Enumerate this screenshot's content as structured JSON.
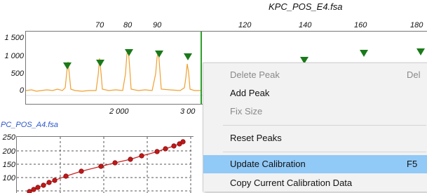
{
  "file_title": "KPC_POS_E4.fsa",
  "top_plot": {
    "x_ticks_upper": [
      "70",
      "80",
      "90",
      "120",
      "140",
      "160",
      "180"
    ],
    "x_ticks_lower": [
      "2 000",
      "3 00"
    ],
    "y_ticks": [
      "1 500",
      "1 000",
      "500",
      "0"
    ],
    "colors": {
      "trace": "#f0a030",
      "marker": "#1a7a1a",
      "cursor": "#2aa12a"
    }
  },
  "cal_plot": {
    "title": "PC_POS_A4.fsa",
    "y_ticks": [
      "250",
      "200",
      "150",
      "100"
    ],
    "colors": {
      "line": "#cc2222",
      "point": "#c21818",
      "title": "#2a56c6"
    }
  },
  "context_menu": {
    "items": [
      {
        "label": "Delete Peak",
        "shortcut": "Del",
        "enabled": false
      },
      {
        "label": "Add Peak",
        "shortcut": "",
        "enabled": true
      },
      {
        "label": "Fix Size",
        "shortcut": "",
        "enabled": false
      },
      {
        "label": "Reset Peaks",
        "shortcut": "",
        "enabled": true
      },
      {
        "label": "Update Calibration",
        "shortcut": "F5",
        "enabled": true,
        "highlighted": true
      },
      {
        "label": "Copy Current Calibration Data",
        "shortcut": "",
        "enabled": true
      }
    ],
    "highlight_color": "#91c9f7"
  }
}
